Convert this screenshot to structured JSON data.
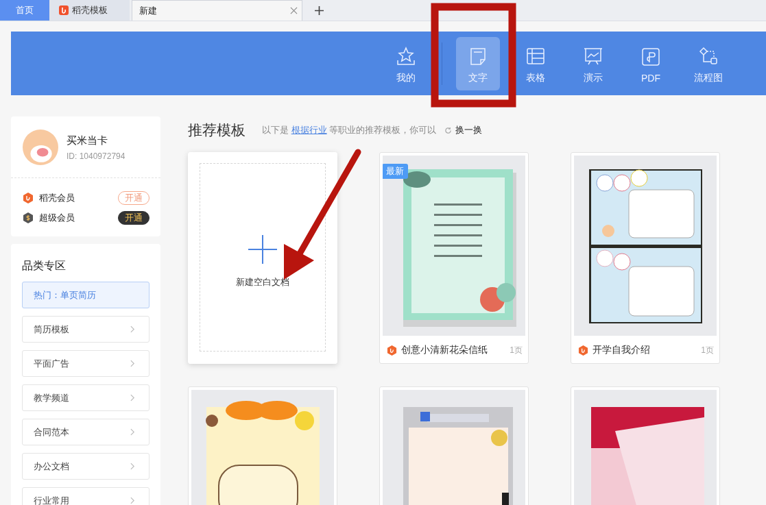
{
  "tabs": [
    {
      "label": "首页",
      "kind": "home",
      "selected": false
    },
    {
      "label": "稻壳模板",
      "kind": "docer",
      "selected": false
    },
    {
      "label": "新建",
      "kind": "new",
      "selected": true
    }
  ],
  "toolbar": [
    {
      "label": "我的",
      "kind": "star",
      "selected": false
    },
    {
      "label": "文字",
      "kind": "doc",
      "selected": true
    },
    {
      "label": "表格",
      "kind": "sheet",
      "selected": false
    },
    {
      "label": "演示",
      "kind": "slide",
      "selected": false
    },
    {
      "label": "PDF",
      "kind": "pdf",
      "selected": false
    },
    {
      "label": "流程图",
      "kind": "flow",
      "selected": false
    }
  ],
  "profile": {
    "name": "买米当卡",
    "id": "ID: 1040972794",
    "memberships": [
      {
        "name": "稻壳会员",
        "action": "开通",
        "kind": "docer"
      },
      {
        "name": "超级会员",
        "action": "开通",
        "kind": "super"
      }
    ]
  },
  "categories": {
    "title": "品类专区",
    "items": [
      {
        "label": "热门：单页简历",
        "selected": true
      },
      {
        "label": "简历模板",
        "selected": false
      },
      {
        "label": "平面广告",
        "selected": false
      },
      {
        "label": "教学频道",
        "selected": false
      },
      {
        "label": "合同范本",
        "selected": false
      },
      {
        "label": "办公文档",
        "selected": false
      },
      {
        "label": "行业常用",
        "selected": false
      }
    ]
  },
  "recommend": {
    "title": "推荐模板",
    "intro_before": "以下是",
    "intro_link": "根据行业",
    "intro_after": "等职业的推荐模板，你可以",
    "refresh": "换一换"
  },
  "templates": [
    {
      "kind": "blank",
      "label": "新建空白文档"
    },
    {
      "kind": "template",
      "badge": "最新",
      "title": "创意小清新花朵信纸",
      "pages": "1页"
    },
    {
      "kind": "template",
      "title": "开学自我介绍",
      "pages": "1页"
    },
    {
      "kind": "template"
    },
    {
      "kind": "template"
    },
    {
      "kind": "template"
    }
  ],
  "annotations": {
    "frame": {
      "color": "#b8150e"
    },
    "arrow": {
      "color": "#b8150e"
    }
  }
}
